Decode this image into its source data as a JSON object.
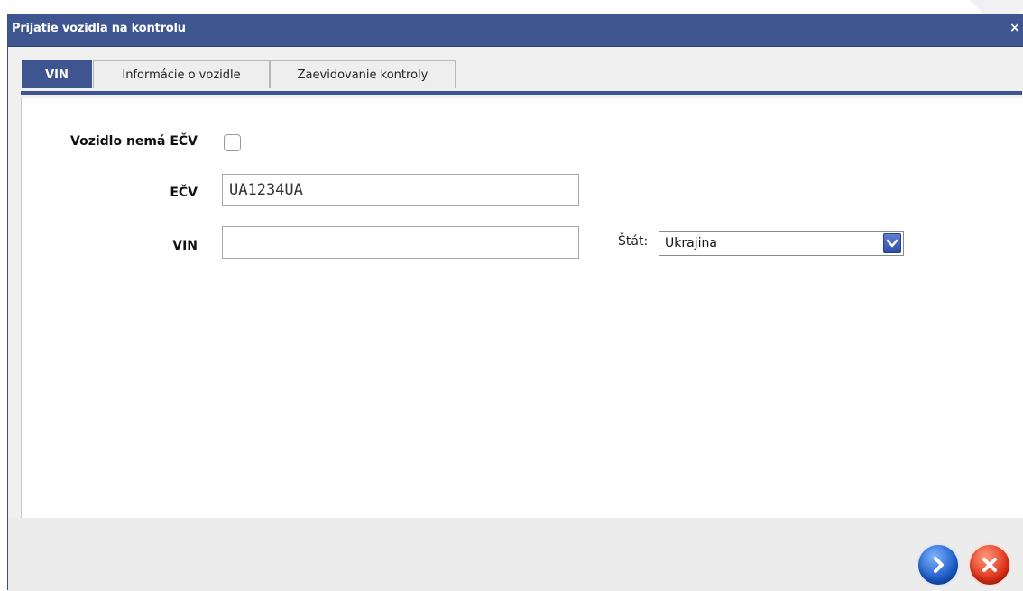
{
  "window": {
    "title": "Prijatie vozidla na kontrolu",
    "close_label": "×"
  },
  "tabs": [
    {
      "label": "VIN",
      "active": true
    },
    {
      "label": "Informácie o vozidle",
      "active": false
    },
    {
      "label": "Zaevidovanie kontroly",
      "active": false
    }
  ],
  "form": {
    "no_plate_label": "Vozidlo nemá EČV",
    "no_plate_checked": false,
    "plate_label": "EČV",
    "plate_value": "UA1234UA",
    "vin_label": "VIN",
    "vin_value": "",
    "state_label": "Štát:",
    "state_value": "Ukrajina"
  },
  "footer": {
    "next_icon": "chevron-right-icon",
    "cancel_icon": "x-icon"
  },
  "colors": {
    "accent": "#3e5590",
    "next_button": "#1d5cc8",
    "cancel_button": "#e0321a"
  }
}
